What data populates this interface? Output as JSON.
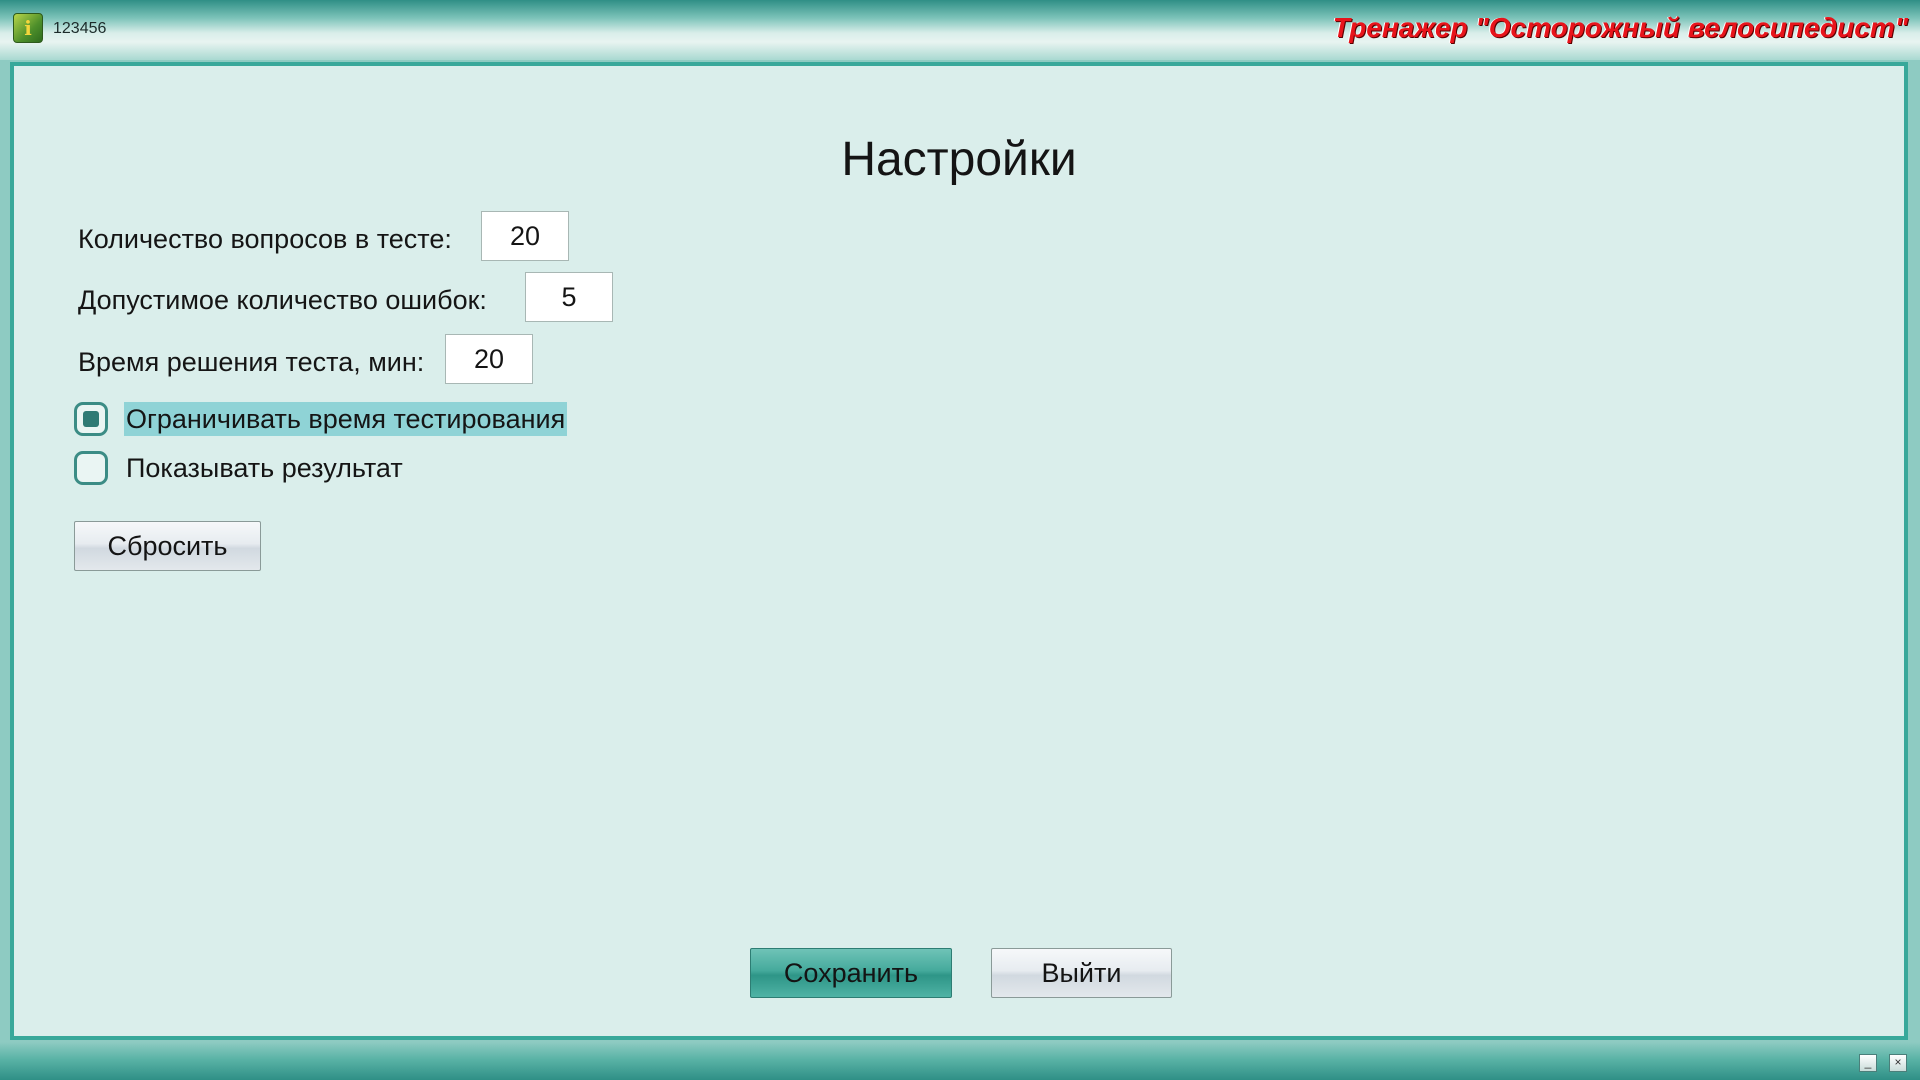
{
  "header": {
    "user_id": "123456",
    "app_title": "Тренажер \"Осторожный велосипедист\"",
    "app_icon": "trainer-app-icon"
  },
  "settings": {
    "title": "Настройки",
    "questions_label": "Количество вопросов в тесте:",
    "questions_value": "20",
    "errors_label": "Допустимое количество ошибок:",
    "errors_value": "5",
    "time_label": "Время решения теста, мин:",
    "time_value": "20",
    "limit_time_label": "Ограничивать время тестирования",
    "limit_time_checked": true,
    "show_result_label": "Показывать результат",
    "show_result_checked": false,
    "reset_label": "Сбросить"
  },
  "footer": {
    "save_label": "Сохранить",
    "exit_label": "Выйти"
  },
  "window_controls": {
    "minimize_icon": "minimize-icon",
    "close_icon": "close-icon"
  },
  "colors": {
    "frame": "#38a89a",
    "panel_bg": "#daeeeb",
    "title_red": "#e8141b",
    "focus_highlight": "#8fd3d6",
    "primary_button": "#45aa9c"
  }
}
